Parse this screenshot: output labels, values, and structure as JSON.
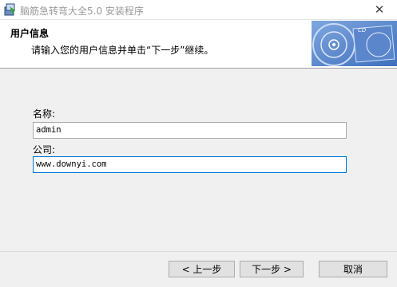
{
  "window": {
    "title": "脑筋急转弯大全5.0 安装程序",
    "app_icon": "installer-icon",
    "close_glyph": "✕"
  },
  "header": {
    "title": "用户信息",
    "description": "请输入您的用户信息并单击“下一步”继续。",
    "banner_text": "CD"
  },
  "form": {
    "name_label": "名称:",
    "name_value": "admin",
    "company_label": "公司:",
    "company_value": "www.downyi.com"
  },
  "buttons": {
    "back": "< 上一步",
    "next": "下一步 >",
    "cancel": "取消"
  },
  "colors": {
    "focus_border": "#0078d7",
    "banner_blue": "#4a78c2"
  }
}
